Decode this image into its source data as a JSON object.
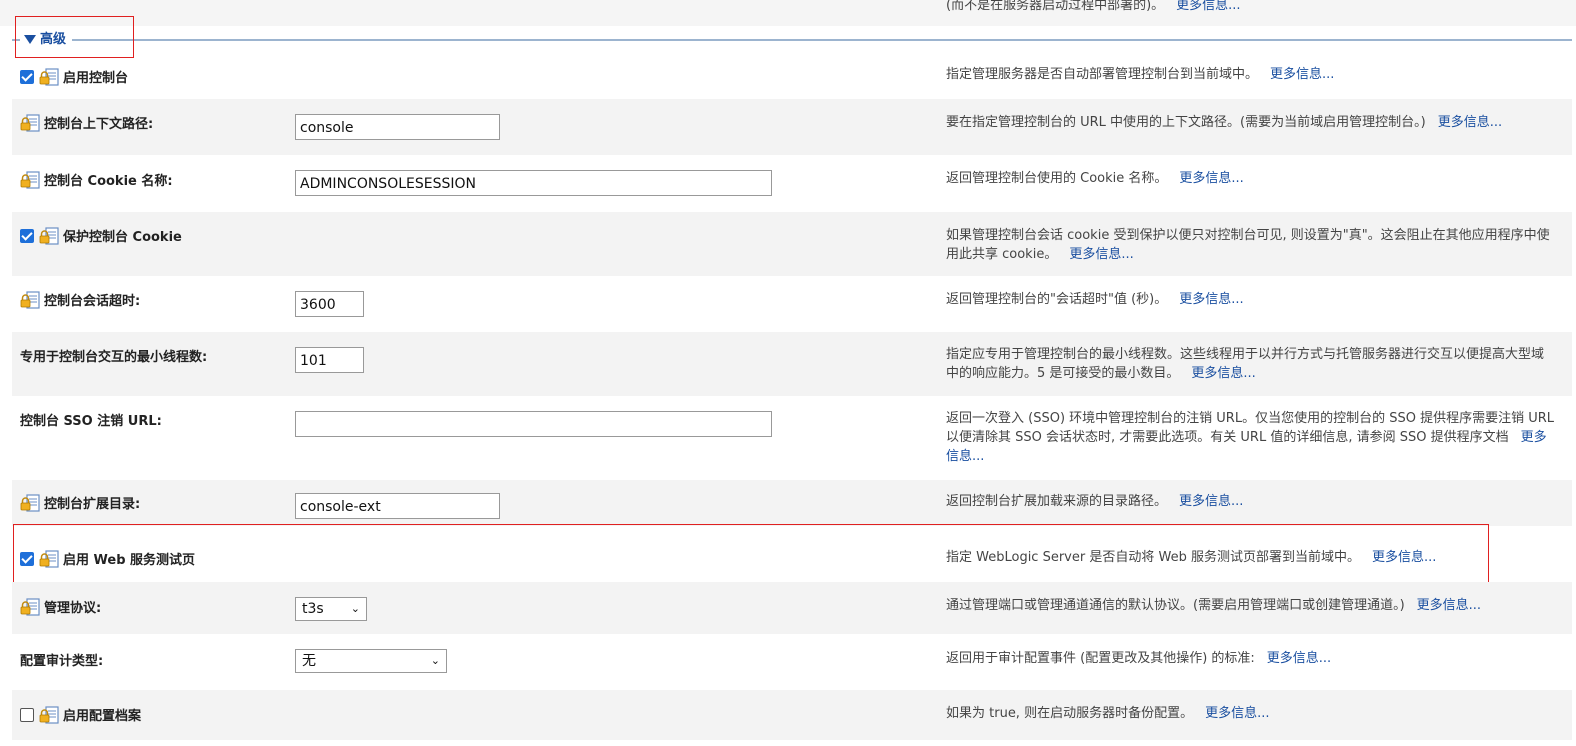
{
  "top_desc": "(而不是在服务器启动过程中部署的)。",
  "more_info": "更多信息...",
  "section": {
    "title": "高级"
  },
  "rows": [
    {
      "label": "启用控制台",
      "desc": "指定管理服务器是否自动部署管理控制台到当前域中。",
      "checked": true
    },
    {
      "label": "控制台上下文路径:",
      "value": "console",
      "desc": "要在指定管理控制台的 URL 中使用的上下文路径。(需要为当前域启用管理控制台。)"
    },
    {
      "label": "控制台 Cookie 名称:",
      "value": "ADMINCONSOLESESSION",
      "desc": "返回管理控制台使用的 Cookie 名称。"
    },
    {
      "label": "保护控制台 Cookie",
      "desc": "如果管理控制台会话 cookie 受到保护以便只对控制台可见, 则设置为\"真\"。这会阻止在其他应用程序中使用此共享 cookie。",
      "checked": true
    },
    {
      "label": "控制台会话超时:",
      "value": "3600",
      "desc": "返回管理控制台的\"会话超时\"值 (秒)。"
    },
    {
      "label": "专用于控制台交互的最小线程数:",
      "value": "101",
      "desc": "指定应专用于管理控制台的最小线程数。这些线程用于以并行方式与托管服务器进行交互以便提高大型域中的响应能力。5 是可接受的最小数目。"
    },
    {
      "label": "控制台 SSO 注销 URL:",
      "value": "",
      "desc": "返回一次登入 (SSO) 环境中管理控制台的注销 URL。仅当您使用的控制台的 SSO 提供程序需要注销 URL 以便清除其 SSO 会话状态时, 才需要此选项。有关 URL 值的详细信息, 请参阅 SSO 提供程序文档"
    },
    {
      "label": "控制台扩展目录:",
      "value": "console-ext",
      "desc": "返回控制台扩展加载来源的目录路径。"
    },
    {
      "label": "启用 Web 服务测试页",
      "desc": "指定 WebLogic Server 是否自动将 Web 服务测试页部署到当前域中。",
      "checked": true
    },
    {
      "label": "管理协议:",
      "value": "t3s",
      "desc": "通过管理端口或管理通道通信的默认协议。(需要启用管理端口或创建管理通道。)"
    },
    {
      "label": "配置审计类型:",
      "value": "无",
      "desc": "返回用于审计配置事件 (配置更改及其他操作) 的标准:"
    },
    {
      "label": "启用配置档案",
      "desc": "如果为 true, 则在启动服务器时备份配置。",
      "checked": false
    }
  ]
}
